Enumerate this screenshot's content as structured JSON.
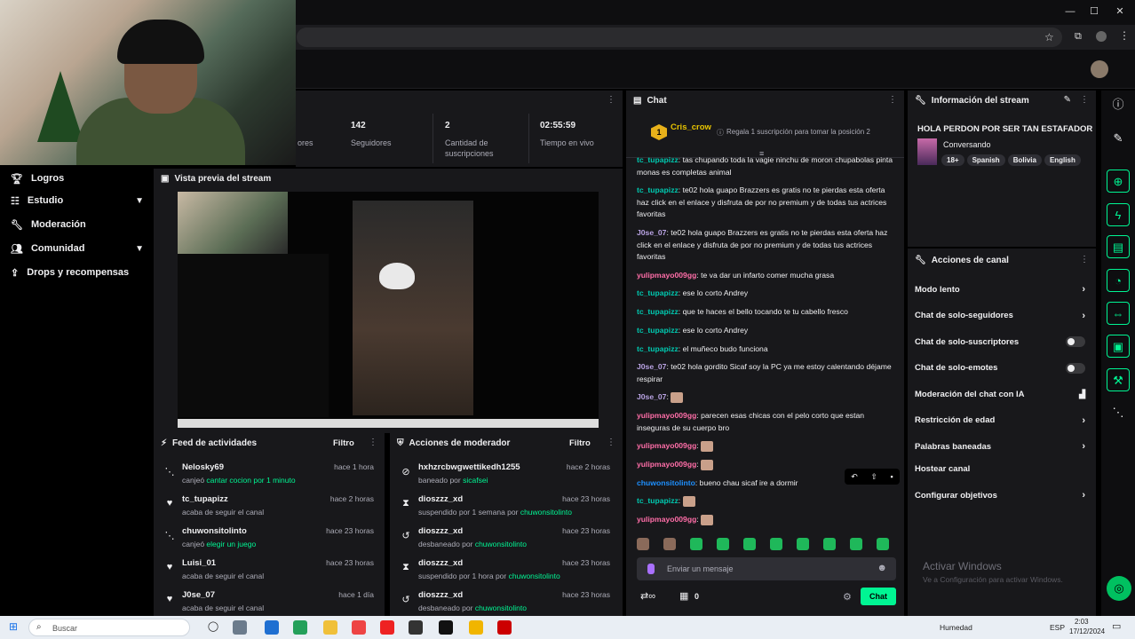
{
  "browser": {
    "window_controls": [
      "—",
      "☐",
      "✕"
    ]
  },
  "stats": [
    {
      "value": "",
      "label": "ores"
    },
    {
      "value": "142",
      "label": "Seguidores"
    },
    {
      "value": "2",
      "label": "Cantidad de suscripciones"
    },
    {
      "value": "02:55:59",
      "label": "Tiempo en vivo"
    }
  ],
  "nav": {
    "items": [
      {
        "label": "Logros",
        "icon": "trophy-icon"
      },
      {
        "label": "Estudio",
        "icon": "studio-icon",
        "expand": true
      },
      {
        "label": "Moderación",
        "icon": "wrench-icon"
      },
      {
        "label": "Comunidad",
        "icon": "community-icon",
        "expand": true
      },
      {
        "label": "Drops y recompensas",
        "icon": "gift-icon"
      }
    ]
  },
  "preview": {
    "title": "Vista previa del stream"
  },
  "activity_feed": {
    "title": "Feed de actividades",
    "filter": "Filtro",
    "items": [
      {
        "icon": "share-icon",
        "name": "Nelosky69",
        "desc_prefix": "canjeó ",
        "desc_highlight": "cantar cocion por 1 minuto",
        "time": "hace 1 hora"
      },
      {
        "icon": "heart-icon",
        "name": "tc_tupapizz",
        "desc_prefix": "acaba de seguir el canal",
        "desc_highlight": "",
        "time": "hace 2 horas"
      },
      {
        "icon": "share-icon",
        "name": "chuwonsitolinto",
        "desc_prefix": "canjeó ",
        "desc_highlight": "elegir un juego",
        "time": "hace 23 horas"
      },
      {
        "icon": "heart-icon",
        "name": "Luisi_01",
        "desc_prefix": "acaba de seguir el canal",
        "desc_highlight": "",
        "time": "hace 23 horas"
      },
      {
        "icon": "heart-icon",
        "name": "J0se_07",
        "desc_prefix": "acaba de seguir el canal",
        "desc_highlight": "",
        "time": "hace 1 día"
      }
    ]
  },
  "mod_actions": {
    "title": "Acciones de moderador",
    "filter": "Filtro",
    "items": [
      {
        "icon": "ban-icon",
        "name": "hxhzrcbwgwettikedh1255",
        "desc_prefix": "baneado por ",
        "desc_highlight": "sicafsei",
        "time": "hace 2 horas"
      },
      {
        "icon": "hourglass-icon",
        "name": "dioszzz_xd",
        "desc_prefix": "suspendido por 1 semana por ",
        "desc_highlight": "chuwonsitolinto",
        "time": "hace 23 horas"
      },
      {
        "icon": "undo-icon",
        "name": "dioszzz_xd",
        "desc_prefix": "desbaneado por ",
        "desc_highlight": "chuwonsitolinto",
        "time": "hace 23 horas"
      },
      {
        "icon": "hourglass-icon",
        "name": "dioszzz_xd",
        "desc_prefix": "suspendido por 1 hora por ",
        "desc_highlight": "chuwonsitolinto",
        "time": "hace 23 horas"
      },
      {
        "icon": "undo-icon",
        "name": "dioszzz_xd",
        "desc_prefix": "desbaneado por ",
        "desc_highlight": "chuwonsitolinto",
        "time": "hace 23 horas"
      }
    ]
  },
  "chat": {
    "title": "Chat",
    "pinned_user": "Cris_crow",
    "pinned_badge": "1",
    "pinned_note": "Regala 1 suscripción para tomar la posición 2",
    "messages": [
      {
        "user": "tc_tupapizz",
        "color": "#00c8af",
        "text": "tas chupando toda la vagie ninchu de moron chupabolas pinta monas es completas animal"
      },
      {
        "user": "tc_tupapizz",
        "color": "#00c8af",
        "text": "te02 hola guapo Brazzers es gratis no te pierdas esta oferta haz click en el enlace y disfruta de por no premium y de todas tus actrices favoritas"
      },
      {
        "user": "J0se_07",
        "color": "#b9a3e3",
        "text": "te02 hola guapo Brazzers es gratis no te pierdas esta oferta haz click en el enlace y disfruta de por no premium y de todas tus actrices favoritas"
      },
      {
        "user": "yulipmayo009gg",
        "color": "#ff6ea8",
        "text": "te va dar un infarto comer mucha grasa"
      },
      {
        "user": "tc_tupapizz",
        "color": "#00c8af",
        "text": "ese lo corto Andrey"
      },
      {
        "user": "tc_tupapizz",
        "color": "#00c8af",
        "text": "que te haces el bello tocando te tu cabello fresco"
      },
      {
        "user": "tc_tupapizz",
        "color": "#00c8af",
        "text": "ese lo corto Andrey"
      },
      {
        "user": "tc_tupapizz",
        "color": "#00c8af",
        "text": "el muñeco budo funciona"
      },
      {
        "user": "J0se_07",
        "color": "#b9a3e3",
        "text": "te02 hola gordito Sicaf soy la PC ya me estoy calentando déjame respirar"
      },
      {
        "user": "J0se_07",
        "color": "#b9a3e3",
        "text": ""
      },
      {
        "user": "yulipmayo009gg",
        "color": "#ff6ea8",
        "text": "parecen esas chicas con el pelo corto que estan inseguras de su cuerpo bro"
      },
      {
        "user": "yulipmayo009gg",
        "color": "#ff6ea8",
        "text": ""
      },
      {
        "user": "yulipmayo009gg",
        "color": "#ff6ea8",
        "text": ""
      },
      {
        "user": "chuwonsitolinto",
        "color": "#1e90ff",
        "text": "bueno chau sicaf ire a dormir"
      },
      {
        "user": "tc_tupapizz",
        "color": "#00c8af",
        "text": ""
      },
      {
        "user": "yulipmayo009gg",
        "color": "#ff6ea8",
        "text": ""
      }
    ],
    "input_placeholder": "Enviar un mensaje",
    "points": "0",
    "send_label": "Chat"
  },
  "stream_info": {
    "title": "Información del stream",
    "stream_title": "HOLA PERDON POR SER TAN ESTAFADOR",
    "category": "Conversando",
    "tags": [
      "18+",
      "Spanish",
      "Bolivia",
      "English"
    ]
  },
  "channel_actions": {
    "title": "Acciones de canal",
    "items": [
      {
        "label": "Modo lento",
        "control": "chevron"
      },
      {
        "label": "Chat de solo-seguidores",
        "control": "chevron"
      },
      {
        "label": "Chat de solo-suscriptores",
        "control": "toggle"
      },
      {
        "label": "Chat de solo-emotes",
        "control": "toggle"
      },
      {
        "label": "Moderación del chat con IA",
        "control": "chart"
      },
      {
        "label": "Restricción de edad",
        "control": "chevron"
      },
      {
        "label": "Palabras baneadas",
        "control": "chevron"
      },
      {
        "label": "Hostear canal",
        "control": "none"
      },
      {
        "label": "Configurar objetivos",
        "control": "chevron"
      }
    ]
  },
  "watermark": {
    "line1": "Activar Windows",
    "line2": "Ve a Configuración para activar Windows."
  },
  "taskbar": {
    "search_placeholder": "Buscar",
    "weather": "Humedad",
    "lang": "ESP",
    "time": "2:03",
    "date": "17/12/2024"
  },
  "colors": {
    "accent": "#00f593",
    "panel": "#18181b",
    "background": "#000000"
  }
}
